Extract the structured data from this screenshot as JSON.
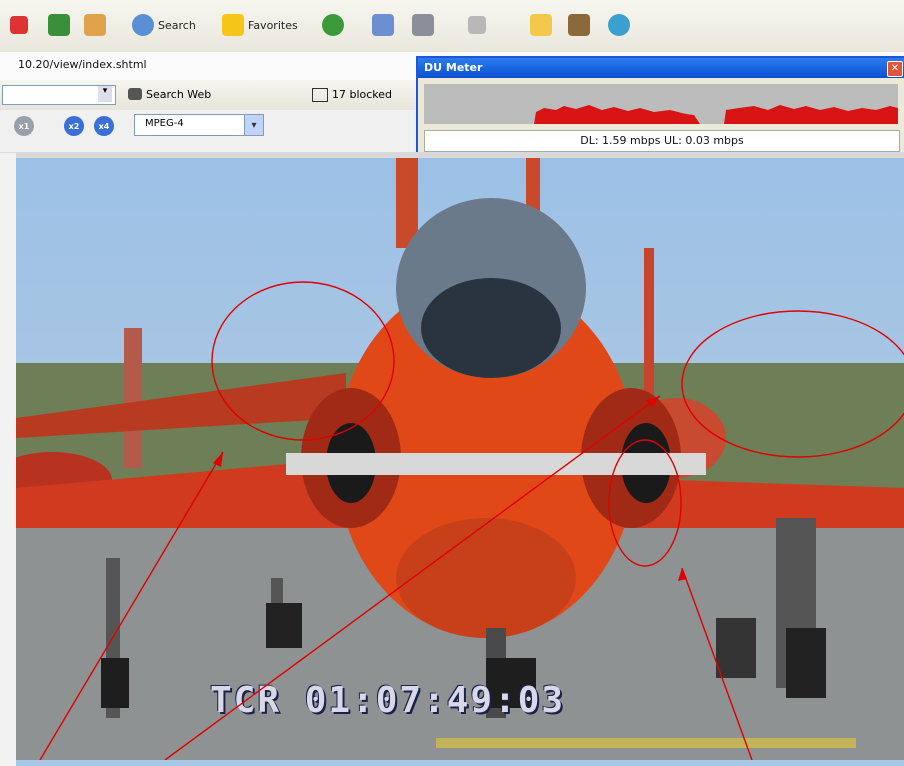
{
  "toolbar": {
    "search_label": "Search",
    "favorites_label": "Favorites"
  },
  "address": {
    "url": "10.20/view/index.shtml"
  },
  "links": {
    "search_web_label": "Search Web",
    "blocked_label": "17 blocked"
  },
  "controls": {
    "zoom": [
      "x1",
      "x2",
      "x4"
    ],
    "codec": "MPEG-4"
  },
  "du_meter": {
    "title": "DU Meter",
    "rates": "DL: 1.59 mbps  UL: 0.03 mbps"
  },
  "video": {
    "timecode": "TCR 01:07:49:03"
  },
  "colors": {
    "annotation": "#e00000",
    "du_title": "#0b4fd0",
    "graph_fill": "#e01010"
  }
}
